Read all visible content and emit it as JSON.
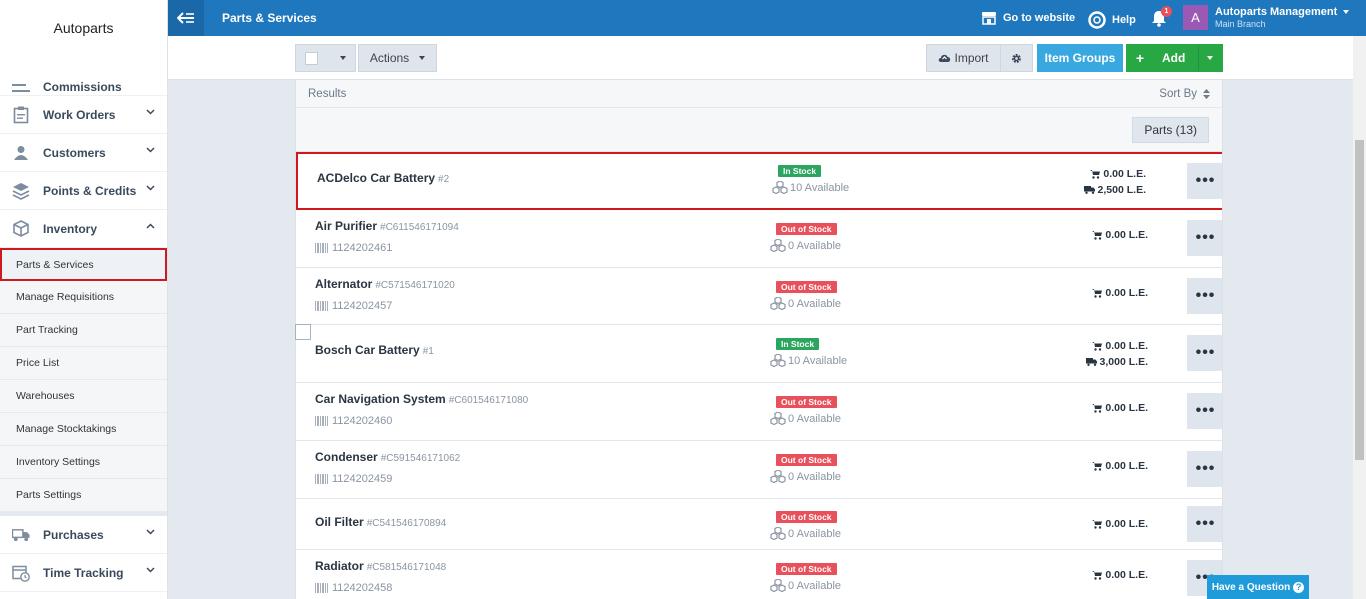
{
  "sidebar": {
    "brand": "Autoparts",
    "items": [
      {
        "label": "Commissions",
        "icon": "commissions-icon"
      },
      {
        "label": "Work Orders",
        "icon": "clipboard-icon"
      },
      {
        "label": "Customers",
        "icon": "users-icon"
      },
      {
        "label": "Points & Credits",
        "icon": "layers-icon"
      },
      {
        "label": "Inventory",
        "icon": "box-icon"
      }
    ],
    "sub_items": [
      "Parts & Services",
      "Manage Requisitions",
      "Part Tracking",
      "Price List",
      "Warehouses",
      "Manage Stocktakings",
      "Inventory Settings",
      "Parts Settings"
    ],
    "bottom_items": [
      {
        "label": "Purchases",
        "icon": "truck-icon"
      },
      {
        "label": "Time Tracking",
        "icon": "calendar-clock-icon"
      }
    ]
  },
  "topbar": {
    "title": "Parts & Services",
    "go_to_website": "Go to website",
    "help": "Help",
    "notification_count": "1",
    "avatar_letter": "A",
    "user_name": "Autoparts Management",
    "branch": "Main Branch"
  },
  "toolbar": {
    "actions": "Actions",
    "import": "Import",
    "item_groups": "Item Groups",
    "add": "Add"
  },
  "results": {
    "header": "Results",
    "sort_by": "Sort By",
    "parts_count": "Parts (13)"
  },
  "rows": [
    {
      "name": "ACDelco Car Battery",
      "code": "#2",
      "barcode": "",
      "status": "In Stock",
      "available": "10 Available",
      "sell_price": "0.00 L.E.",
      "buy_price": "2,500 L.E."
    },
    {
      "name": "Air Purifier",
      "code": "#C611546171094",
      "barcode": "1124202461",
      "status": "Out of Stock",
      "available": "0 Available",
      "sell_price": "0.00 L.E.",
      "buy_price": ""
    },
    {
      "name": "Alternator",
      "code": "#C571546171020",
      "barcode": "1124202457",
      "status": "Out of Stock",
      "available": "0 Available",
      "sell_price": "0.00 L.E.",
      "buy_price": ""
    },
    {
      "name": "Bosch Car Battery",
      "code": "#1",
      "barcode": "",
      "status": "In Stock",
      "available": "10 Available",
      "sell_price": "0.00 L.E.",
      "buy_price": "3,000 L.E."
    },
    {
      "name": "Car Navigation System",
      "code": "#C601546171080",
      "barcode": "1124202460",
      "status": "Out of Stock",
      "available": "0 Available",
      "sell_price": "0.00 L.E.",
      "buy_price": ""
    },
    {
      "name": "Condenser",
      "code": "#C591546171062",
      "barcode": "1124202459",
      "status": "Out of Stock",
      "available": "0 Available",
      "sell_price": "0.00 L.E.",
      "buy_price": ""
    },
    {
      "name": "Oil Filter",
      "code": "#C541546170894",
      "barcode": "",
      "status": "Out of Stock",
      "available": "0 Available",
      "sell_price": "0.00 L.E.",
      "buy_price": ""
    },
    {
      "name": "Radiator",
      "code": "#C581546171048",
      "barcode": "1124202458",
      "status": "Out of Stock",
      "available": "0 Available",
      "sell_price": "0.00 L.E.",
      "buy_price": ""
    }
  ],
  "more_label": "•••",
  "question": "Have a Question",
  "question_mark": "?"
}
